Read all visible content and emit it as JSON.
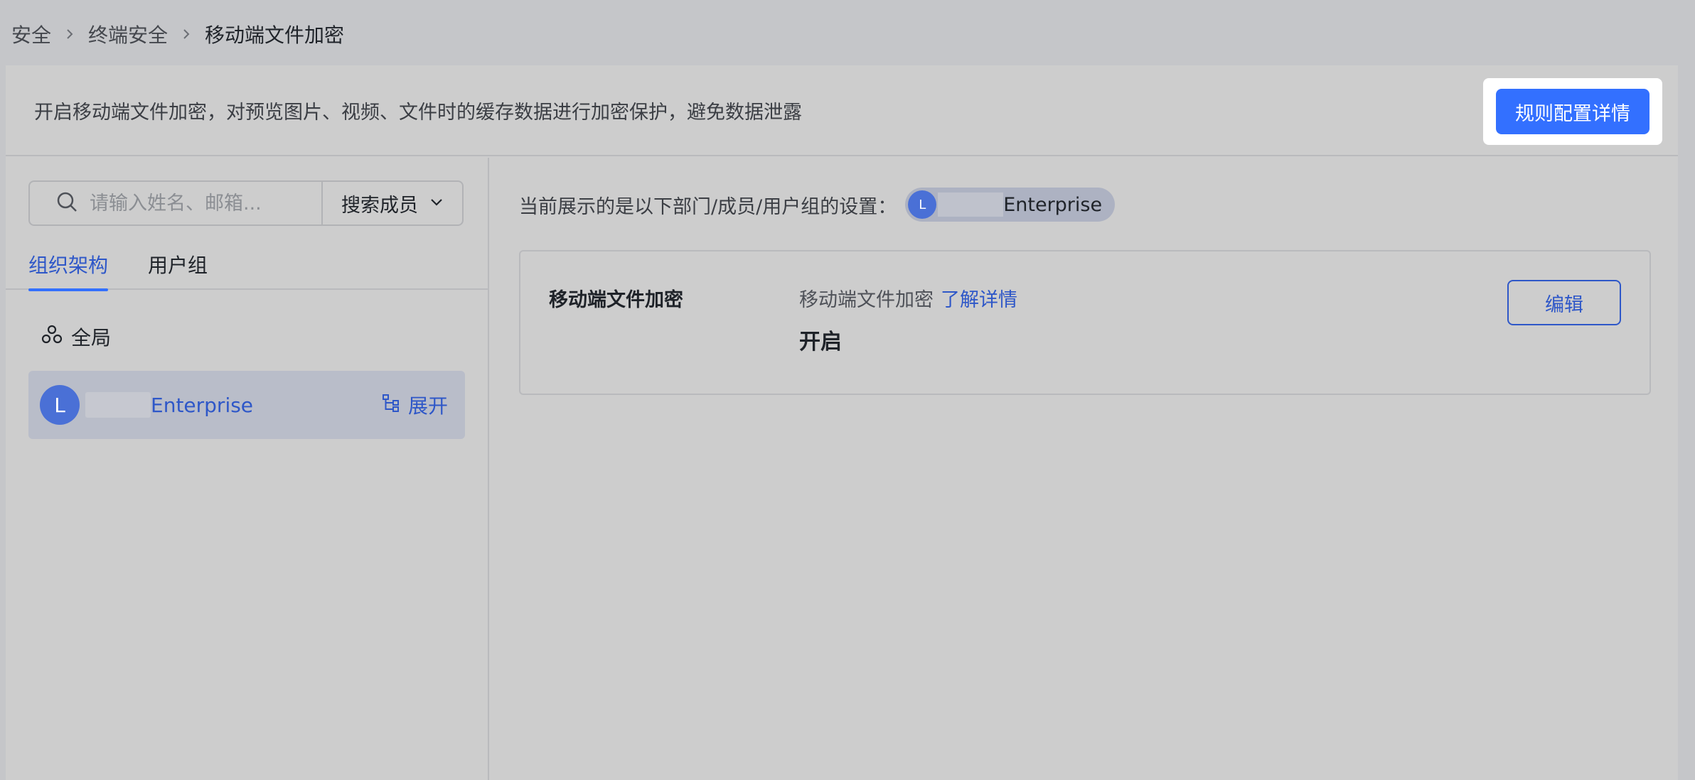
{
  "breadcrumb": {
    "items": [
      "安全",
      "终端安全",
      "移动端文件加密"
    ]
  },
  "banner": {
    "description": "开启移动端文件加密，对预览图片、视频、文件时的缓存数据进行加密保护，避免数据泄露",
    "rule_button": "规则配置详情"
  },
  "left": {
    "search_placeholder": "请输入姓名、邮箱...",
    "search_scope": "搜索成员",
    "tabs": [
      "组织架构",
      "用户组"
    ],
    "global_label": "全局",
    "org": {
      "avatar_letter": "L",
      "name": "Enterprise",
      "expand_label": "展开"
    }
  },
  "right": {
    "scope_text": "当前展示的是以下部门/成员/用户组的设置：",
    "scope_chip": {
      "avatar_letter": "L",
      "name": "Enterprise"
    },
    "card": {
      "title": "移动端文件加密",
      "subtitle": "移动端文件加密",
      "link": "了解详情",
      "status": "开启",
      "edit_button": "编辑"
    }
  },
  "colors": {
    "primary": "#3370ff",
    "link": "#2e57c8",
    "background": "#c5c6c9"
  }
}
